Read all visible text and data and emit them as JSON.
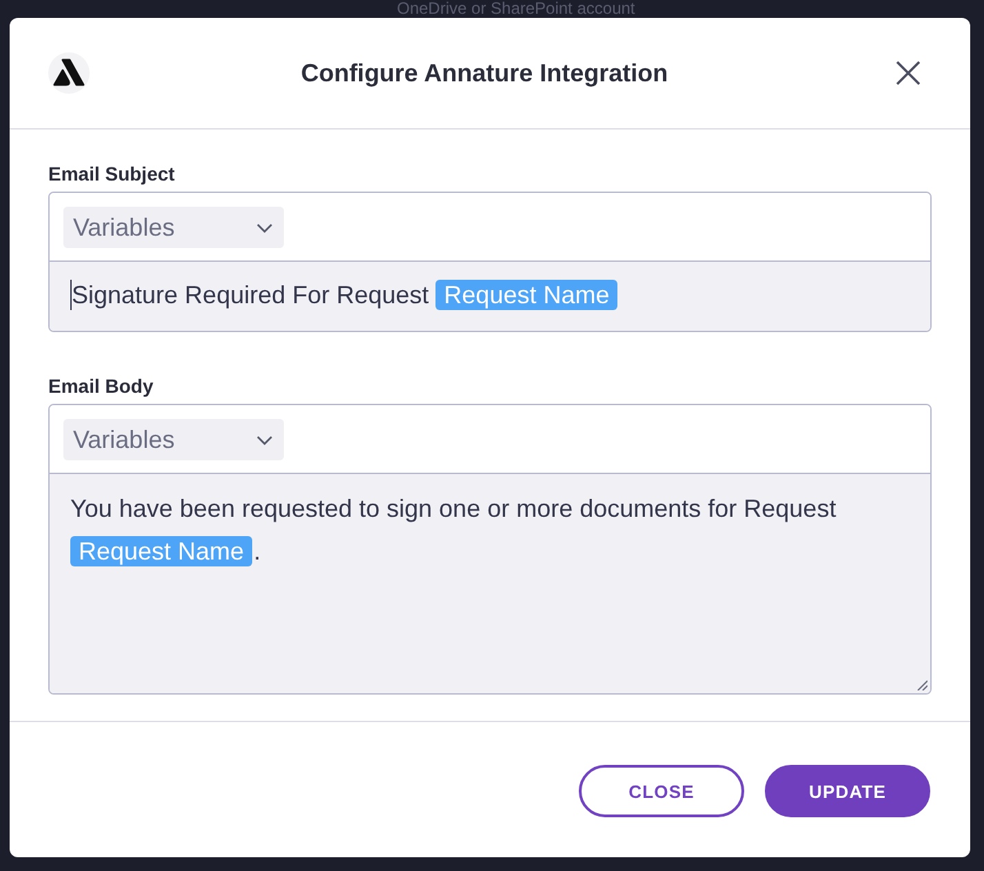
{
  "backdrop": {
    "text": "OneDrive or SharePoint account"
  },
  "dialog": {
    "title": "Configure Annature Integration"
  },
  "fields": [
    {
      "label": "Email Subject",
      "dropdown": {
        "value": "Variables"
      },
      "focused": true,
      "resizable": false,
      "content": [
        {
          "kind": "text",
          "text": "Signature Required For Request"
        },
        {
          "kind": "variable",
          "text": "Request Name"
        }
      ]
    },
    {
      "label": "Email Body",
      "dropdown": {
        "value": "Variables"
      },
      "focused": false,
      "resizable": true,
      "content": [
        {
          "kind": "text",
          "text": "You have been requested to sign one or more documents for Request"
        },
        {
          "kind": "variable",
          "text": "Request Name"
        },
        {
          "kind": "text",
          "text": "."
        }
      ]
    }
  ],
  "buttons": [
    {
      "label": "CLOSE",
      "kind": "outline"
    },
    {
      "label": "UPDATE",
      "kind": "primary"
    }
  ]
}
